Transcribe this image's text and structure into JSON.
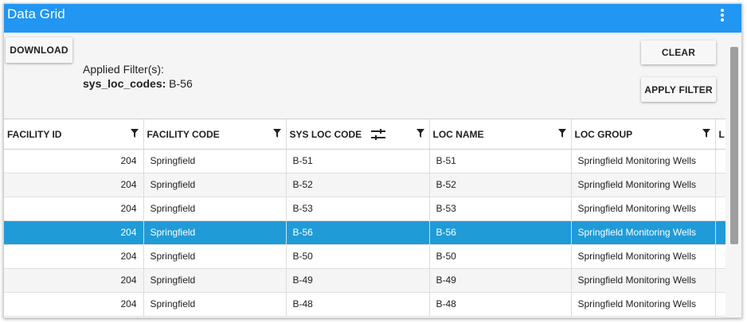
{
  "window": {
    "title": "Data Grid"
  },
  "toolbar": {
    "download_label": "DOWNLOAD",
    "clear_label": "CLEAR",
    "apply_label": "APPLY FILTER"
  },
  "filters": {
    "heading": "Applied Filter(s):",
    "key": "sys_loc_codes:",
    "value": " B-56"
  },
  "grid": {
    "columns": [
      "FACILITY ID",
      "FACILITY CODE",
      "SYS LOC CODE",
      "LOC NAME",
      "LOC GROUP",
      "L"
    ],
    "rows": [
      [
        "204",
        "Springfield",
        "B-51",
        "B-51",
        "Springfield Monitoring Wells"
      ],
      [
        "204",
        "Springfield",
        "B-52",
        "B-52",
        "Springfield Monitoring Wells"
      ],
      [
        "204",
        "Springfield",
        "B-53",
        "B-53",
        "Springfield Monitoring Wells"
      ],
      [
        "204",
        "Springfield",
        "B-56",
        "B-56",
        "Springfield Monitoring Wells"
      ],
      [
        "204",
        "Springfield",
        "B-50",
        "B-50",
        "Springfield Monitoring Wells"
      ],
      [
        "204",
        "Springfield",
        "B-49",
        "B-49",
        "Springfield Monitoring Wells"
      ],
      [
        "204",
        "Springfield",
        "B-48",
        "B-48",
        "Springfield Monitoring Wells"
      ]
    ],
    "selected_row": 3
  },
  "colors": {
    "titlebar": "#2196f3",
    "selected_row": "#1f9bd8",
    "alt_row": "#f5f5f5"
  },
  "icons": {
    "menu": "more-vert-icon",
    "filter": "filter-icon",
    "column_settings": "tune-icon"
  }
}
